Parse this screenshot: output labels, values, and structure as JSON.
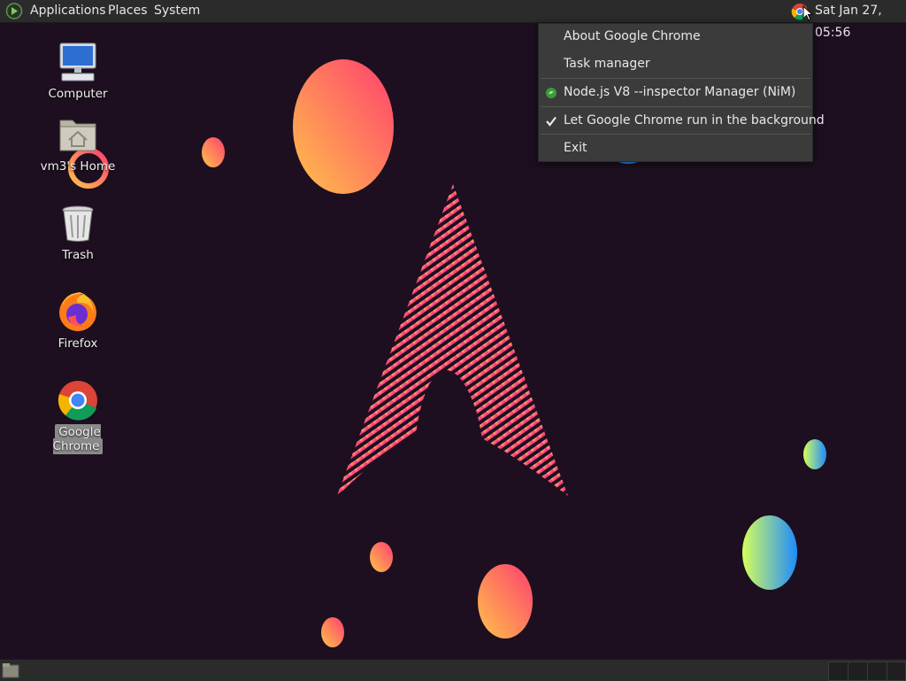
{
  "top_panel": {
    "menus": [
      "Applications",
      "Places",
      "System"
    ],
    "clock": "Sat Jan 27, 05:56"
  },
  "desktop": {
    "icons": [
      {
        "label": "Computer",
        "icon": "computer-icon"
      },
      {
        "label": "vm3's Home",
        "icon": "home-folder-icon"
      },
      {
        "label": "Trash",
        "icon": "trash-icon"
      },
      {
        "label": "Firefox",
        "icon": "firefox-icon"
      },
      {
        "label": "Google Chrome",
        "icon": "chrome-icon",
        "selected": true
      }
    ]
  },
  "context_menu": {
    "items": [
      {
        "label": "About Google Chrome"
      },
      {
        "label": "Task manager"
      },
      {
        "label": "Node.js V8 --inspector Manager (NiM)",
        "icon": "nim-extension-icon"
      },
      {
        "label": "Let Google Chrome run in the background",
        "checked": true
      },
      {
        "label": "Exit"
      }
    ]
  },
  "colors": {
    "panel": "#2b2b2b",
    "background": "#1d0f1f",
    "menu": "#3b3b3b"
  }
}
